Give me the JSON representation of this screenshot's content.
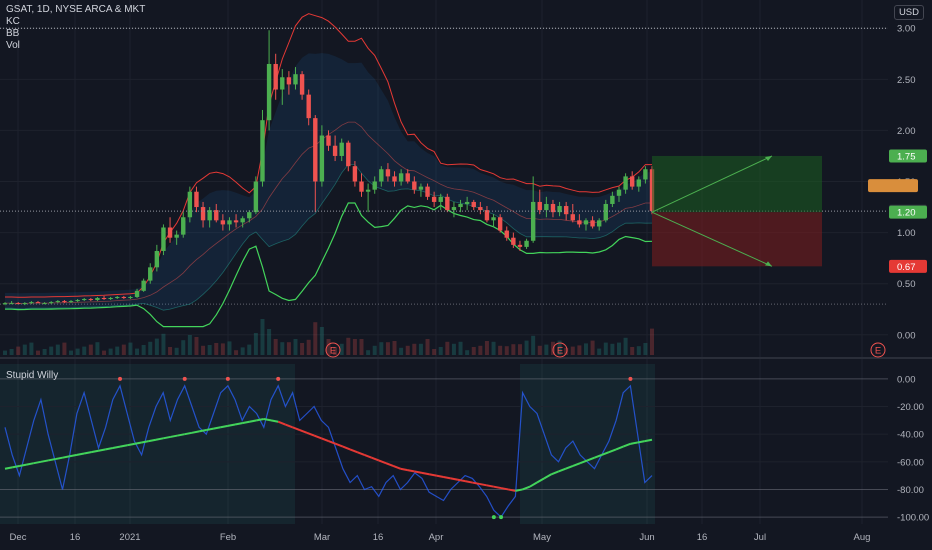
{
  "header": {
    "symbol": "GSAT, 1D, NYSE ARCA & MKT",
    "indicators": [
      "KC",
      "BB",
      "Vol"
    ],
    "currency": "USD"
  },
  "sub_pane": {
    "title": "Stupid Willy"
  },
  "colors": {
    "bg": "#131722",
    "grid": "#1e222d",
    "up": "#26a69a",
    "down": "#ef5350",
    "green_up": "#4caf50",
    "kc_line": "#e53935",
    "bb_line": "#43d45b",
    "price_line": "#9598a1",
    "target": "#4caf50",
    "stop": "#ef5350"
  },
  "chart_data": [
    {
      "type": "candlestick",
      "title": "GSAT, 1D, NYSE ARCA & MKT",
      "y_axis": {
        "min": -0.1,
        "max": 3.1,
        "ticks": [
          "3.00",
          "2.50",
          "2.00",
          "1.50",
          "1.00",
          "0.50",
          "0.00"
        ]
      },
      "x_ticks": [
        "Dec",
        "16",
        "2021",
        "Feb",
        "Mar",
        "16",
        "Apr",
        "May",
        "Jun",
        "16",
        "Jul",
        "Aug"
      ],
      "price_badges": [
        {
          "label": "1.75",
          "value": 1.75,
          "color": "#4caf50"
        },
        {
          "label": "1.21",
          "value": 1.21,
          "color": "#2a2e39"
        },
        {
          "label": "1.20",
          "value": 1.2,
          "color": "#4caf50"
        },
        {
          "label": "0.67",
          "value": 0.67,
          "color": "#e53935"
        },
        {
          "label": "",
          "value": 1.46,
          "color": "#d98e3c"
        }
      ],
      "earnings_markers": [
        "E",
        "E",
        "E"
      ],
      "candles": [
        {
          "o": 0.3,
          "h": 0.32,
          "l": 0.29,
          "c": 0.31
        },
        {
          "o": 0.31,
          "h": 0.33,
          "l": 0.3,
          "c": 0.31
        },
        {
          "o": 0.31,
          "h": 0.32,
          "l": 0.3,
          "c": 0.3
        },
        {
          "o": 0.3,
          "h": 0.32,
          "l": 0.29,
          "c": 0.31
        },
        {
          "o": 0.31,
          "h": 0.33,
          "l": 0.3,
          "c": 0.32
        },
        {
          "o": 0.32,
          "h": 0.33,
          "l": 0.31,
          "c": 0.31
        },
        {
          "o": 0.31,
          "h": 0.32,
          "l": 0.3,
          "c": 0.31
        },
        {
          "o": 0.31,
          "h": 0.33,
          "l": 0.3,
          "c": 0.32
        },
        {
          "o": 0.32,
          "h": 0.34,
          "l": 0.31,
          "c": 0.33
        },
        {
          "o": 0.33,
          "h": 0.34,
          "l": 0.31,
          "c": 0.32
        },
        {
          "o": 0.32,
          "h": 0.34,
          "l": 0.31,
          "c": 0.33
        },
        {
          "o": 0.33,
          "h": 0.35,
          "l": 0.32,
          "c": 0.34
        },
        {
          "o": 0.34,
          "h": 0.36,
          "l": 0.33,
          "c": 0.35
        },
        {
          "o": 0.35,
          "h": 0.36,
          "l": 0.33,
          "c": 0.34
        },
        {
          "o": 0.34,
          "h": 0.37,
          "l": 0.33,
          "c": 0.36
        },
        {
          "o": 0.36,
          "h": 0.38,
          "l": 0.34,
          "c": 0.35
        },
        {
          "o": 0.35,
          "h": 0.37,
          "l": 0.34,
          "c": 0.36
        },
        {
          "o": 0.36,
          "h": 0.38,
          "l": 0.35,
          "c": 0.37
        },
        {
          "o": 0.37,
          "h": 0.38,
          "l": 0.35,
          "c": 0.36
        },
        {
          "o": 0.36,
          "h": 0.38,
          "l": 0.35,
          "c": 0.37
        },
        {
          "o": 0.37,
          "h": 0.45,
          "l": 0.36,
          "c": 0.43
        },
        {
          "o": 0.43,
          "h": 0.55,
          "l": 0.42,
          "c": 0.53
        },
        {
          "o": 0.53,
          "h": 0.7,
          "l": 0.5,
          "c": 0.66
        },
        {
          "o": 0.66,
          "h": 0.88,
          "l": 0.62,
          "c": 0.82
        },
        {
          "o": 0.82,
          "h": 1.08,
          "l": 0.78,
          "c": 1.05
        },
        {
          "o": 1.05,
          "h": 1.15,
          "l": 0.9,
          "c": 0.95
        },
        {
          "o": 0.95,
          "h": 1.02,
          "l": 0.88,
          "c": 0.98
        },
        {
          "o": 0.98,
          "h": 1.2,
          "l": 0.95,
          "c": 1.15
        },
        {
          "o": 1.15,
          "h": 1.45,
          "l": 1.1,
          "c": 1.4
        },
        {
          "o": 1.4,
          "h": 1.45,
          "l": 1.2,
          "c": 1.25
        },
        {
          "o": 1.25,
          "h": 1.3,
          "l": 1.05,
          "c": 1.12
        },
        {
          "o": 1.12,
          "h": 1.25,
          "l": 1.05,
          "c": 1.22
        },
        {
          "o": 1.22,
          "h": 1.28,
          "l": 1.1,
          "c": 1.12
        },
        {
          "o": 1.12,
          "h": 1.18,
          "l": 1.02,
          "c": 1.08
        },
        {
          "o": 1.08,
          "h": 1.15,
          "l": 1.02,
          "c": 1.12
        },
        {
          "o": 1.12,
          "h": 1.18,
          "l": 1.05,
          "c": 1.1
        },
        {
          "o": 1.1,
          "h": 1.16,
          "l": 1.05,
          "c": 1.14
        },
        {
          "o": 1.14,
          "h": 1.22,
          "l": 1.1,
          "c": 1.2
        },
        {
          "o": 1.2,
          "h": 1.55,
          "l": 1.18,
          "c": 1.5
        },
        {
          "o": 1.5,
          "h": 2.2,
          "l": 1.45,
          "c": 2.1
        },
        {
          "o": 2.1,
          "h": 2.98,
          "l": 2.0,
          "c": 2.65
        },
        {
          "o": 2.65,
          "h": 2.75,
          "l": 2.3,
          "c": 2.4
        },
        {
          "o": 2.4,
          "h": 2.6,
          "l": 2.25,
          "c": 2.52
        },
        {
          "o": 2.52,
          "h": 2.58,
          "l": 2.35,
          "c": 2.45
        },
        {
          "o": 2.45,
          "h": 2.62,
          "l": 2.4,
          "c": 2.55
        },
        {
          "o": 2.55,
          "h": 2.58,
          "l": 2.3,
          "c": 2.35
        },
        {
          "o": 2.35,
          "h": 2.4,
          "l": 2.05,
          "c": 2.12
        },
        {
          "o": 2.12,
          "h": 2.15,
          "l": 1.2,
          "c": 1.5
        },
        {
          "o": 1.5,
          "h": 2.05,
          "l": 1.45,
          "c": 1.95
        },
        {
          "o": 1.95,
          "h": 2.0,
          "l": 1.8,
          "c": 1.85
        },
        {
          "o": 1.85,
          "h": 1.95,
          "l": 1.7,
          "c": 1.75
        },
        {
          "o": 1.75,
          "h": 1.92,
          "l": 1.7,
          "c": 1.88
        },
        {
          "o": 1.88,
          "h": 1.9,
          "l": 1.6,
          "c": 1.65
        },
        {
          "o": 1.65,
          "h": 1.7,
          "l": 1.45,
          "c": 1.5
        },
        {
          "o": 1.5,
          "h": 1.58,
          "l": 1.35,
          "c": 1.4
        },
        {
          "o": 1.4,
          "h": 1.48,
          "l": 1.2,
          "c": 1.42
        },
        {
          "o": 1.42,
          "h": 1.55,
          "l": 1.38,
          "c": 1.5
        },
        {
          "o": 1.5,
          "h": 1.65,
          "l": 1.45,
          "c": 1.62
        },
        {
          "o": 1.62,
          "h": 1.68,
          "l": 1.5,
          "c": 1.55
        },
        {
          "o": 1.55,
          "h": 1.6,
          "l": 1.45,
          "c": 1.5
        },
        {
          "o": 1.5,
          "h": 1.62,
          "l": 1.46,
          "c": 1.58
        },
        {
          "o": 1.58,
          "h": 1.62,
          "l": 1.48,
          "c": 1.5
        },
        {
          "o": 1.5,
          "h": 1.55,
          "l": 1.38,
          "c": 1.42
        },
        {
          "o": 1.42,
          "h": 1.48,
          "l": 1.35,
          "c": 1.45
        },
        {
          "o": 1.45,
          "h": 1.48,
          "l": 1.32,
          "c": 1.35
        },
        {
          "o": 1.35,
          "h": 1.4,
          "l": 1.25,
          "c": 1.3
        },
        {
          "o": 1.3,
          "h": 1.38,
          "l": 1.22,
          "c": 1.35
        },
        {
          "o": 1.35,
          "h": 1.38,
          "l": 1.2,
          "c": 1.22
        },
        {
          "o": 1.22,
          "h": 1.3,
          "l": 1.15,
          "c": 1.25
        },
        {
          "o": 1.25,
          "h": 1.32,
          "l": 1.2,
          "c": 1.28
        },
        {
          "o": 1.28,
          "h": 1.35,
          "l": 1.22,
          "c": 1.3
        },
        {
          "o": 1.3,
          "h": 1.32,
          "l": 1.22,
          "c": 1.25
        },
        {
          "o": 1.25,
          "h": 1.3,
          "l": 1.18,
          "c": 1.22
        },
        {
          "o": 1.22,
          "h": 1.26,
          "l": 1.1,
          "c": 1.12
        },
        {
          "o": 1.12,
          "h": 1.18,
          "l": 1.05,
          "c": 1.15
        },
        {
          "o": 1.15,
          "h": 1.18,
          "l": 1.0,
          "c": 1.02
        },
        {
          "o": 1.02,
          "h": 1.06,
          "l": 0.92,
          "c": 0.95
        },
        {
          "o": 0.95,
          "h": 1.0,
          "l": 0.85,
          "c": 0.88
        },
        {
          "o": 0.88,
          "h": 0.92,
          "l": 0.82,
          "c": 0.86
        },
        {
          "o": 0.86,
          "h": 0.94,
          "l": 0.84,
          "c": 0.92
        },
        {
          "o": 0.92,
          "h": 1.55,
          "l": 0.9,
          "c": 1.3
        },
        {
          "o": 1.3,
          "h": 1.42,
          "l": 1.18,
          "c": 1.22
        },
        {
          "o": 1.22,
          "h": 1.35,
          "l": 1.15,
          "c": 1.28
        },
        {
          "o": 1.28,
          "h": 1.32,
          "l": 1.15,
          "c": 1.2
        },
        {
          "o": 1.2,
          "h": 1.3,
          "l": 1.16,
          "c": 1.26
        },
        {
          "o": 1.26,
          "h": 1.3,
          "l": 1.12,
          "c": 1.18
        },
        {
          "o": 1.18,
          "h": 1.28,
          "l": 1.1,
          "c": 1.12
        },
        {
          "o": 1.12,
          "h": 1.18,
          "l": 1.05,
          "c": 1.08
        },
        {
          "o": 1.08,
          "h": 1.14,
          "l": 1.02,
          "c": 1.12
        },
        {
          "o": 1.12,
          "h": 1.16,
          "l": 1.04,
          "c": 1.06
        },
        {
          "o": 1.06,
          "h": 1.14,
          "l": 1.02,
          "c": 1.12
        },
        {
          "o": 1.12,
          "h": 1.32,
          "l": 1.1,
          "c": 1.28
        },
        {
          "o": 1.28,
          "h": 1.4,
          "l": 1.25,
          "c": 1.36
        },
        {
          "o": 1.36,
          "h": 1.45,
          "l": 1.3,
          "c": 1.42
        },
        {
          "o": 1.42,
          "h": 1.58,
          "l": 1.38,
          "c": 1.55
        },
        {
          "o": 1.55,
          "h": 1.6,
          "l": 1.42,
          "c": 1.45
        },
        {
          "o": 1.45,
          "h": 1.55,
          "l": 1.4,
          "c": 1.52
        },
        {
          "o": 1.52,
          "h": 1.65,
          "l": 1.48,
          "c": 1.62
        },
        {
          "o": 1.62,
          "h": 1.65,
          "l": 1.18,
          "c": 1.21
        }
      ]
    },
    {
      "type": "line",
      "title": "Stupid Willy",
      "y_axis": {
        "min": -105,
        "max": 5,
        "ticks": [
          "0.00",
          "-20.00",
          "-40.00",
          "-60.00",
          "-80.00",
          "-100.00"
        ]
      },
      "series": [
        {
          "values": [
            -35,
            -55,
            -70,
            -50,
            -30,
            -15,
            -40,
            -60,
            -80,
            -55,
            -25,
            -10,
            -30,
            -50,
            -35,
            -15,
            -5,
            -25,
            -45,
            -55,
            -35,
            -20,
            -10,
            -30,
            -15,
            -5,
            -20,
            -35,
            -40,
            -25,
            -10,
            -5,
            -15,
            -30,
            -20,
            -25,
            -35,
            -15,
            -5,
            -20,
            -10,
            -30,
            -25,
            -20,
            -30,
            -35,
            -50,
            -65,
            -75,
            -70,
            -80,
            -78,
            -85,
            -75,
            -70,
            -80,
            -75,
            -68,
            -72,
            -82,
            -85,
            -88,
            -80,
            -75,
            -70,
            -72,
            -78,
            -85,
            -95,
            -100,
            -92,
            -85,
            -10,
            -20,
            -25,
            -40,
            -55,
            -60,
            -50,
            -45,
            -55,
            -60,
            -65,
            -55,
            -45,
            -30,
            -10,
            -5,
            -40,
            -75,
            -70
          ]
        },
        {
          "values": [
            -65,
            -64,
            -63,
            -62,
            -61,
            -60,
            -59,
            -58,
            -57,
            -56,
            -55,
            -54,
            -53,
            -52,
            -51,
            -50,
            -49,
            -48,
            -47,
            -46,
            -45,
            -44,
            -43,
            -42,
            -41,
            -40,
            -39,
            -38,
            -37,
            -36,
            -35,
            -34,
            -33,
            -32,
            -31,
            -30,
            -29,
            -30,
            -31,
            -33,
            -35,
            -37,
            -39,
            -41,
            -43,
            -45,
            -47,
            -49,
            -51,
            -53,
            -55,
            -57,
            -59,
            -61,
            -63,
            -65,
            -66,
            -67,
            -68,
            -69,
            -70,
            -71,
            -72,
            -73,
            -74,
            -75,
            -76,
            -77,
            -78,
            -79,
            -80,
            -81,
            -80,
            -78,
            -75,
            -72,
            -69,
            -67,
            -65,
            -63,
            -61,
            -59,
            -57,
            -55,
            -53,
            -51,
            -49,
            -47,
            -46,
            -45,
            -44
          ]
        }
      ]
    }
  ]
}
